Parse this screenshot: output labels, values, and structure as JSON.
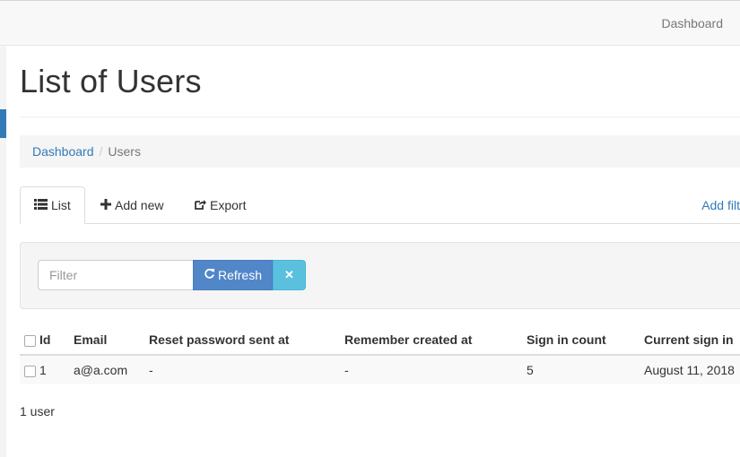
{
  "navbar": {
    "dashboard_link": "Dashboard"
  },
  "page": {
    "title": "List of Users"
  },
  "breadcrumb": {
    "items": [
      "Dashboard",
      "Users"
    ],
    "separator": "/"
  },
  "tabs": [
    {
      "label": "List",
      "icon": "list-icon",
      "active": true
    },
    {
      "label": "Add new",
      "icon": "plus-icon"
    },
    {
      "label": "Export",
      "icon": "share-icon"
    }
  ],
  "add_filter_label": "Add filt",
  "filter": {
    "placeholder": "Filter",
    "refresh_label": "Refresh",
    "clear_icon": "close-icon"
  },
  "table": {
    "columns": [
      "Id",
      "Email",
      "Reset password sent at",
      "Remember created at",
      "Sign in count",
      "Current sign in"
    ],
    "rows": [
      {
        "id": "1",
        "email": "a@a.com",
        "reset_password_sent_at": "-",
        "remember_created_at": "-",
        "sign_in_count": "5",
        "current_sign_in": "August 11, 2018"
      }
    ]
  },
  "footer": {
    "count_label": "1 user"
  },
  "colors": {
    "link": "#337ab7",
    "primary_button": "#5187c9",
    "info_button": "#5bc0de"
  }
}
